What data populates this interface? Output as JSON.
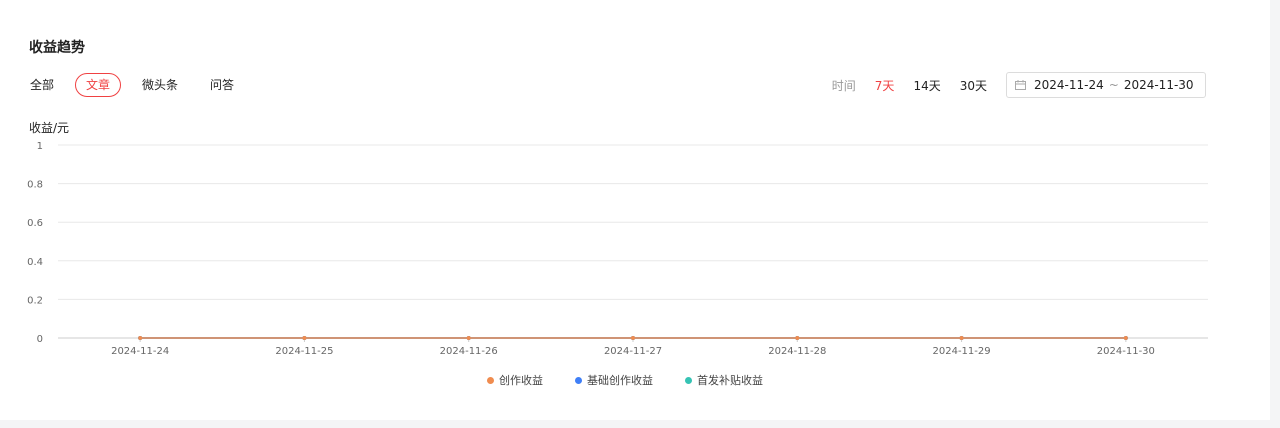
{
  "section": {
    "title": "收益趋势"
  },
  "tabs": [
    {
      "label": "全部",
      "active": false
    },
    {
      "label": "文章",
      "active": true
    },
    {
      "label": "微头条",
      "active": false
    },
    {
      "label": "问答",
      "active": false
    }
  ],
  "time_filter": {
    "label": "时间",
    "ranges": [
      {
        "label": "7天",
        "active": true
      },
      {
        "label": "14天",
        "active": false
      },
      {
        "label": "30天",
        "active": false
      }
    ],
    "date_range": {
      "start": "2024-11-24",
      "separator": "~",
      "end": "2024-11-30"
    }
  },
  "colors": {
    "accent": "#f04142",
    "series_1": "#f08c4f",
    "series_2": "#3f7ff7",
    "series_3": "#36c3b4",
    "grid": "#e8e8e8",
    "axis": "#cccccc"
  },
  "chart_data": {
    "type": "line",
    "ylabel": "收益/元",
    "ylim": [
      0,
      1
    ],
    "yticks": [
      "0",
      "0.2",
      "0.4",
      "0.6",
      "0.8",
      "1"
    ],
    "x": [
      "2024-11-24",
      "2024-11-25",
      "2024-11-26",
      "2024-11-27",
      "2024-11-28",
      "2024-11-29",
      "2024-11-30"
    ],
    "series": [
      {
        "name": "创作收益",
        "color": "#f08c4f",
        "values": [
          0,
          0,
          0,
          0,
          0,
          0,
          0
        ]
      },
      {
        "name": "基础创作收益",
        "color": "#3f7ff7",
        "values": [
          0,
          0,
          0,
          0,
          0,
          0,
          0
        ]
      },
      {
        "name": "首发补贴收益",
        "color": "#36c3b4",
        "values": [
          0,
          0,
          0,
          0,
          0,
          0,
          0
        ]
      }
    ],
    "grid": true,
    "legend_position": "bottom-center"
  }
}
